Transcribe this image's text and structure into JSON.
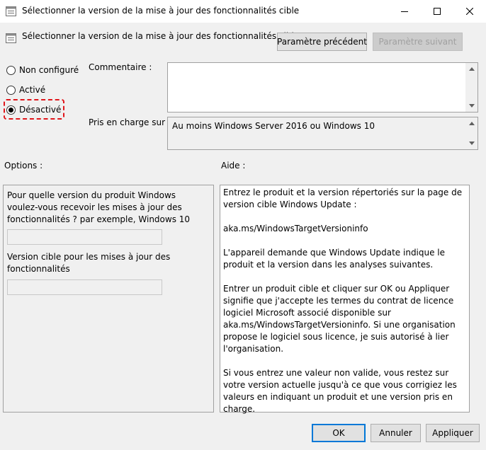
{
  "window": {
    "title": "Sélectionner la version de la mise à jour des fonctionnalités cible",
    "minimize_glyph": "—",
    "maximize_glyph": "☐",
    "close_glyph": "✕"
  },
  "header": {
    "title": "Sélectionner la version de la mise à jour des fonctionnalités cible",
    "prev_label": "Paramètre précédent",
    "next_label": "Paramètre suivant"
  },
  "radios": [
    {
      "label": "Non configuré",
      "checked": false
    },
    {
      "label": "Activé",
      "checked": false
    },
    {
      "label": "Désactivé",
      "checked": true
    }
  ],
  "annotation_color": "#e0161b",
  "labels": {
    "comment": "Commentaire :",
    "supported_on": "Pris en charge sur :",
    "options": "Options :",
    "help": "Aide :"
  },
  "comment": {
    "value": ""
  },
  "supported_on": {
    "value": "Au moins Windows Server 2016 ou Windows 10"
  },
  "options": {
    "question1": "Pour quelle version du produit Windows voulez-vous recevoir les mises à jour des fonctionnalités ? par exemple, Windows 10",
    "input1_value": "",
    "question2": "Version cible pour les mises à jour des fonctionnalités",
    "input2_value": ""
  },
  "help": {
    "paragraphs": [
      "Entrez le produit et la version répertoriés sur la page de version cible Windows Update :",
      "aka.ms/WindowsTargetVersioninfo",
      "L'appareil demande que Windows Update indique le produit et la version dans les analyses suivantes.",
      "Entrer un produit cible et cliquer sur OK ou Appliquer signifie que j'accepte les termes du contrat de licence logiciel Microsoft associé disponible sur aka.ms/WindowsTargetVersioninfo. Si une organisation propose le logiciel sous licence, je suis autorisé à lier l'organisation.",
      "Si vous entrez une valeur non valide, vous restez sur votre version actuelle jusqu'à ce que vous corrigiez les valeurs en indiquant un produit et une version pris en charge."
    ]
  },
  "footer": {
    "ok_label": "OK",
    "cancel_label": "Annuler",
    "apply_label": "Appliquer"
  },
  "icons": {
    "window": "policy-settings-icon",
    "header": "policy-settings-icon"
  }
}
